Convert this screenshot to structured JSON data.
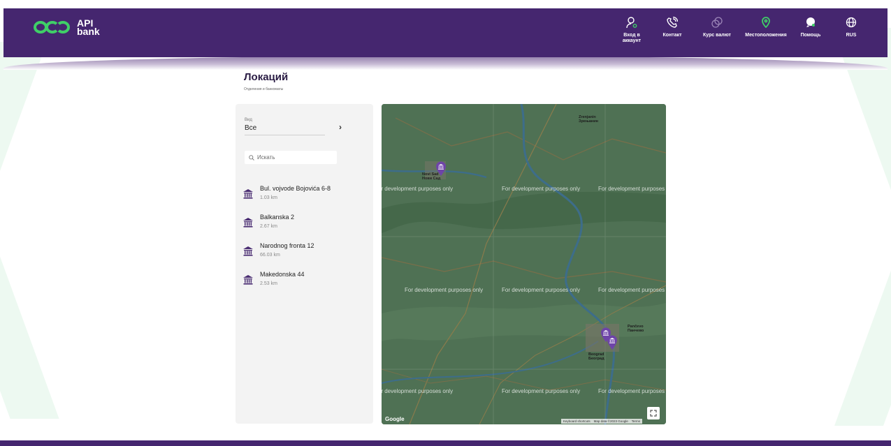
{
  "brand": {
    "logo_mark": "api",
    "name_line1": "API",
    "name_line2": "bank",
    "accent_color": "#3fcf67",
    "primary_color": "#45266f"
  },
  "nav": {
    "items": [
      {
        "label": "Вход в\nаккаунт",
        "icon": "user-icon"
      },
      {
        "label": "Контакт",
        "icon": "phone-icon"
      },
      {
        "label": "Курс валют",
        "icon": "exchange-icon"
      },
      {
        "label": "Местоположения",
        "icon": "location-pin-icon",
        "active": true
      },
      {
        "label": "Помощь",
        "icon": "chat-help-icon"
      },
      {
        "label": "RUS",
        "icon": "globe-icon"
      }
    ]
  },
  "page": {
    "title": "Локаций",
    "subtitle": "Отделения и банкоматы"
  },
  "filter": {
    "label": "Вид",
    "value": "Все"
  },
  "search": {
    "placeholder": "Искать"
  },
  "locations": [
    {
      "name": "Bul. vojvode Bojovića 6-8",
      "distance": "1.03 km"
    },
    {
      "name": "Balkanska 2",
      "distance": "2.67 km"
    },
    {
      "name": "Narodnog fronta 12",
      "distance": "66.03 km"
    },
    {
      "name": "Makedonska 44",
      "distance": "2.53 km"
    }
  ],
  "map": {
    "watermark": "For development purposes only",
    "provider_logo": "Google",
    "attribution": {
      "shortcuts": "Keyboard shortcuts",
      "data": "Map data ©2023 Google",
      "terms": "Terms"
    },
    "cities": {
      "novi_sad": "Novi Sad\nНови Сад",
      "beograd": "Beograd\nБеоград",
      "zrenjanin": "Zrenjanin\nЗрењанин",
      "pancevo": "Pančevo\nПанчево"
    }
  }
}
